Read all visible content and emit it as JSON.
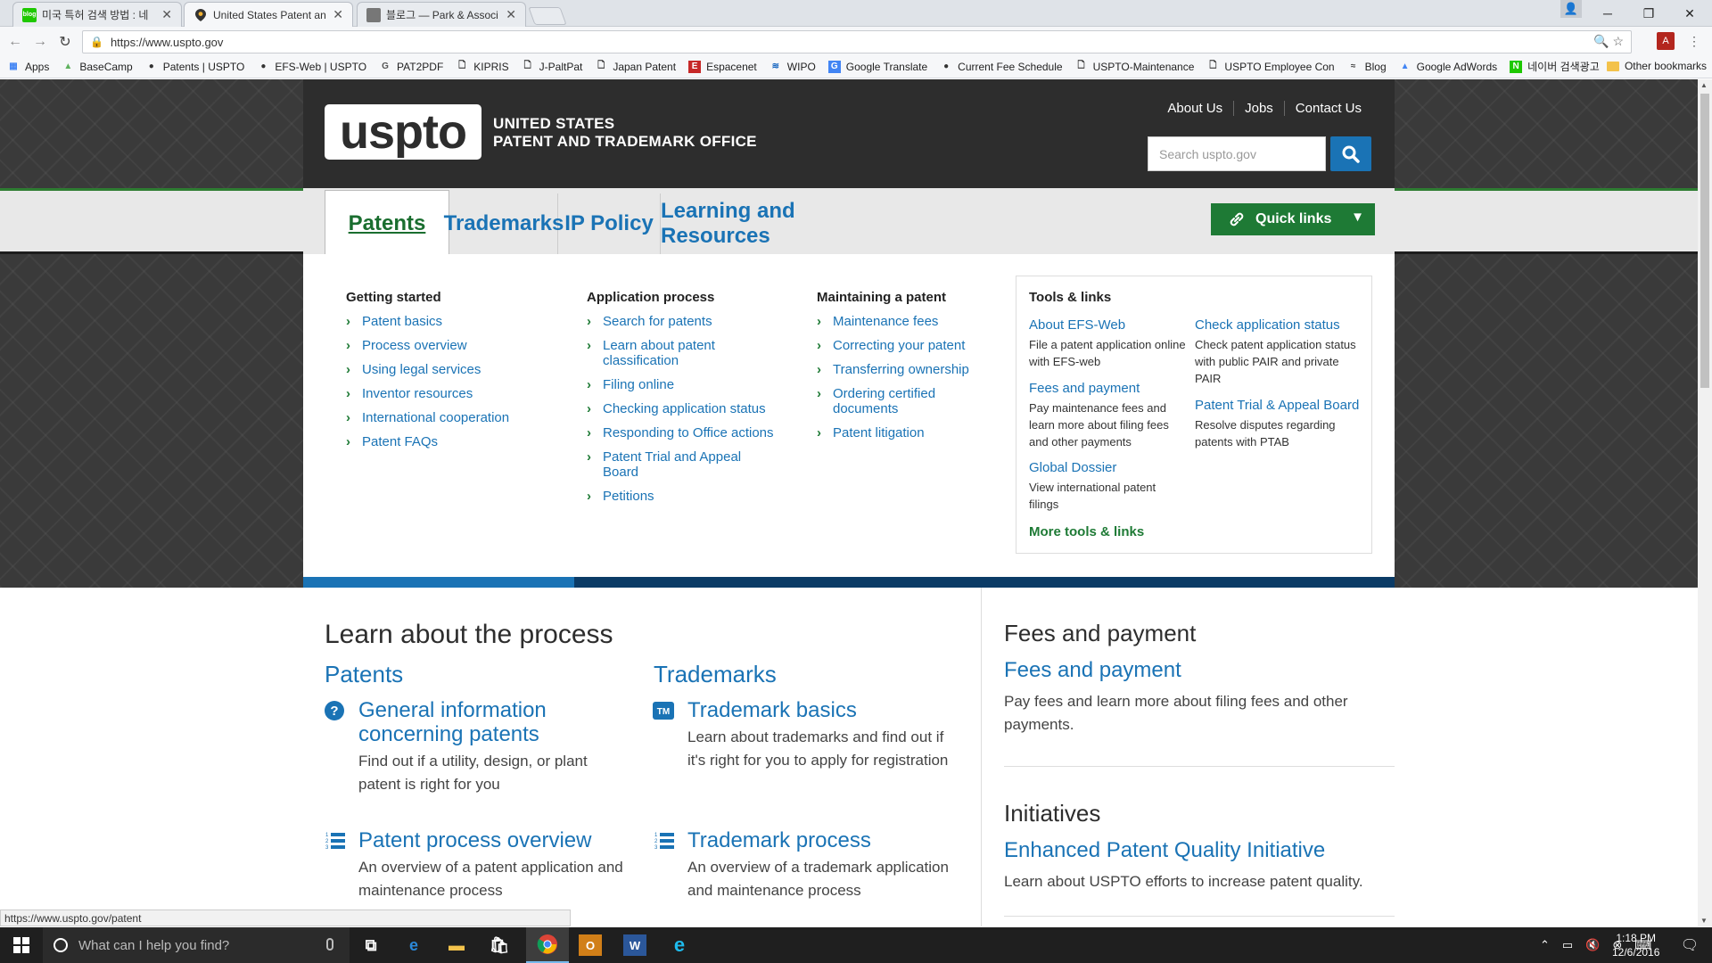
{
  "browser": {
    "tabs": [
      {
        "label": "미국 특허 검색 방법 : 네",
        "icon": "naver-blog-icon",
        "icon_text": "blog"
      },
      {
        "label": "United States Patent and",
        "icon": "uspto-pin-icon",
        "icon_text": ""
      },
      {
        "label": "블로그 — Park & Associ",
        "icon": "cube-icon",
        "icon_text": ""
      }
    ],
    "url": "https://www.uspto.gov",
    "bookmarks": [
      {
        "label": "Apps",
        "icon": "apps-grid-icon"
      },
      {
        "label": "BaseCamp",
        "icon": "basecamp-icon"
      },
      {
        "label": "Patents | USPTO",
        "icon": "uspto-pin-icon"
      },
      {
        "label": "EFS-Web | USPTO",
        "icon": "uspto-pin-icon"
      },
      {
        "label": "PAT2PDF",
        "icon": "g-letter-icon"
      },
      {
        "label": "KIPRIS",
        "icon": "page-icon"
      },
      {
        "label": "J-PaltPat",
        "icon": "page-icon"
      },
      {
        "label": "Japan Patent",
        "icon": "page-icon"
      },
      {
        "label": "Espacenet",
        "icon": "e-letter-icon"
      },
      {
        "label": "WIPO",
        "icon": "wipo-icon"
      },
      {
        "label": "Google Translate",
        "icon": "translate-icon"
      },
      {
        "label": "Current Fee Schedule",
        "icon": "uspto-pin-icon"
      },
      {
        "label": "USPTO-Maintenance",
        "icon": "page-icon"
      },
      {
        "label": "USPTO Employee Con",
        "icon": "page-icon"
      },
      {
        "label": "Blog",
        "icon": "blog-icon"
      },
      {
        "label": "Google AdWords",
        "icon": "adwords-icon"
      },
      {
        "label": "네이버 검색광고",
        "icon": "naver-n-icon"
      }
    ],
    "other_bookmarks": "Other bookmarks",
    "status_url": "https://www.uspto.gov/patent"
  },
  "header": {
    "logo": "uspto",
    "office_line1": "UNITED STATES",
    "office_line2": "PATENT AND TRADEMARK OFFICE",
    "links": [
      "About Us",
      "Jobs",
      "Contact Us"
    ],
    "search_placeholder": "Search uspto.gov"
  },
  "nav": {
    "tabs": [
      "Patents",
      "Trademarks",
      "IP Policy",
      "Learning and Resources"
    ],
    "active": "Patents",
    "quick_links": "Quick links"
  },
  "mega": {
    "columns": [
      {
        "heading": "Getting started",
        "items": [
          "Patent basics",
          "Process overview",
          "Using legal services",
          "Inventor resources",
          "International cooperation",
          "Patent FAQs"
        ]
      },
      {
        "heading": "Application process",
        "items": [
          "Search for patents",
          "Learn about patent classification",
          "Filing online",
          "Checking application status",
          "Responding to Office actions",
          "Patent Trial and Appeal Board",
          "Petitions"
        ]
      },
      {
        "heading": "Maintaining a patent",
        "items": [
          "Maintenance fees",
          "Correcting your patent",
          "Transferring ownership",
          "Ordering certified documents",
          "Patent litigation"
        ]
      }
    ],
    "tools": {
      "heading": "Tools & links",
      "left": [
        {
          "title": "About EFS-Web",
          "desc": "File a patent application online with EFS-web"
        },
        {
          "title": "Fees and payment",
          "desc": "Pay maintenance fees and learn more about filing fees and other payments"
        },
        {
          "title": "Global Dossier",
          "desc": "View international patent filings"
        }
      ],
      "right": [
        {
          "title": "Check application status",
          "desc": "Check patent application status with public PAIR and private PAIR"
        },
        {
          "title": "Patent Trial & Appeal Board",
          "desc": "Resolve disputes regarding patents with PTAB"
        }
      ],
      "more": "More tools & links"
    }
  },
  "content": {
    "title": "Learn about the process",
    "patents": {
      "heading": "Patents",
      "cards": [
        {
          "title": "General information concerning patents",
          "desc": "Find out if a utility, design, or plant patent is right for you",
          "icon": "question-circle-icon"
        },
        {
          "title": "Patent process overview",
          "desc": "An overview of a patent application and maintenance process",
          "icon": "numbered-list-icon"
        }
      ]
    },
    "trademarks": {
      "heading": "Trademarks",
      "cards": [
        {
          "title": "Trademark basics",
          "desc": "Learn about trademarks and find out if it's right for you to apply for registration",
          "icon": "tm-badge-icon"
        },
        {
          "title": "Trademark process",
          "desc": "An overview of a trademark application and maintenance process",
          "icon": "numbered-list-icon"
        }
      ]
    },
    "fees": {
      "heading": "Fees and payment",
      "title": "Fees and payment",
      "desc": "Pay fees and learn more about filing fees and other payments."
    },
    "initiatives": {
      "heading": "Initiatives",
      "title": "Enhanced Patent Quality Initiative",
      "desc": "Learn about USPTO efforts to increase patent quality."
    }
  },
  "taskbar": {
    "search_placeholder": "What can I help you find?",
    "time": "1:18 PM",
    "date": "12/6/2016"
  },
  "colors": {
    "link_blue": "#1a73b5",
    "green": "#1e7a35",
    "header_dark": "#2d2d2d"
  }
}
